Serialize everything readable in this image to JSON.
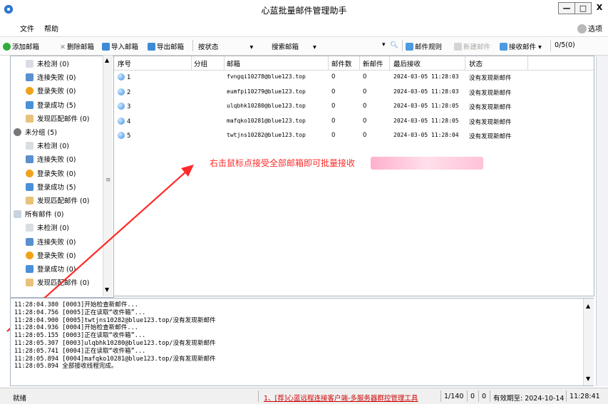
{
  "window": {
    "title": "心蓝批量邮件管理助手",
    "buttons": [
      "—",
      "□",
      "X"
    ]
  },
  "menubar": {
    "items": [
      "文件",
      "帮助"
    ],
    "options_label": "选项"
  },
  "toolbar": {
    "add": "添加邮箱",
    "delete": "删除邮箱",
    "import": "导入邮箱",
    "export": "导出邮箱",
    "status_filter": "按状态",
    "search_placeholder": "搜索邮箱",
    "search_arrow": "▾",
    "rules": "邮件规则",
    "new_mail": "新建邮件",
    "receive": "接收邮件",
    "counter": "0/5(0)"
  },
  "tree": {
    "items": [
      {
        "label": "未检测 (0)",
        "indent": 1,
        "icon": "question-icon"
      },
      {
        "label": "连接失败 (0)",
        "indent": 1,
        "icon": "connect-fail-icon"
      },
      {
        "label": "登录失败 (0)",
        "indent": 1,
        "icon": "login-fail-icon"
      },
      {
        "label": "登录成功 (5)",
        "indent": 1,
        "icon": "login-success-icon"
      },
      {
        "label": "发现匹配邮件 (0)",
        "indent": 1,
        "icon": "match-mail-icon"
      },
      {
        "label": "未分组 (5)",
        "indent": 0,
        "icon": "person-icon"
      },
      {
        "label": "未检测 (0)",
        "indent": 1,
        "icon": "question-icon"
      },
      {
        "label": "连接失败 (0)",
        "indent": 1,
        "icon": "connect-fail-icon"
      },
      {
        "label": "登录失败 (0)",
        "indent": 1,
        "icon": "login-fail-icon"
      },
      {
        "label": "登录成功 (5)",
        "indent": 1,
        "icon": "login-success-icon"
      },
      {
        "label": "发现匹配邮件 (0)",
        "indent": 1,
        "icon": "match-mail-icon"
      },
      {
        "label": "所有邮件 (0)",
        "indent": 0,
        "icon": "all-mail-icon"
      },
      {
        "label": "未检测 (0)",
        "indent": 1,
        "icon": "question-icon"
      },
      {
        "label": "连接失败 (0)",
        "indent": 1,
        "icon": "connect-fail-icon"
      },
      {
        "label": "登录失败 (0)",
        "indent": 1,
        "icon": "login-fail-icon"
      },
      {
        "label": "登录成功 (0)",
        "indent": 1,
        "icon": "login-success-icon"
      },
      {
        "label": "发现匹配邮件 (0)",
        "indent": 1,
        "icon": "match-mail-icon"
      }
    ]
  },
  "grid": {
    "columns": [
      "序号",
      "分组",
      "邮箱",
      "邮件数",
      "新邮件",
      "最后接收",
      "状态"
    ],
    "rows": [
      {
        "no": "1",
        "group": "",
        "email": "fvngqi10278@blue123.top",
        "count": "0",
        "new": "0",
        "last": "2024-03-05 11:28:03",
        "status": "没有发现新邮件"
      },
      {
        "no": "2",
        "group": "",
        "email": "eumfpi10279@blue123.top",
        "count": "0",
        "new": "0",
        "last": "2024-03-05 11:28:03",
        "status": "没有发现新邮件"
      },
      {
        "no": "3",
        "group": "",
        "email": "ulqbhk10280@blue123.top",
        "count": "0",
        "new": "0",
        "last": "2024-03-05 11:28:05",
        "status": "没有发现新邮件"
      },
      {
        "no": "4",
        "group": "",
        "email": "mafqko10281@blue123.top",
        "count": "0",
        "new": "0",
        "last": "2024-03-05 11:28:05",
        "status": "没有发现新邮件"
      },
      {
        "no": "5",
        "group": "",
        "email": "twtjns10282@blue123.top",
        "count": "0",
        "new": "0",
        "last": "2024-03-05 11:28:04",
        "status": "没有发现新邮件"
      }
    ]
  },
  "annotation": {
    "text": "右击鼠标点接受全部邮箱即可批量接收",
    "color": "#ff2a2a"
  },
  "log": {
    "lines": [
      "11:28:04.380 [0003]开始检查新邮件...",
      "11:28:04.756 [0005]正在读取“收件箱”...",
      "11:28:04.900 [0005]twtjns10282@blue123.top/没有发现新邮件",
      "11:28:04.936 [0004]开始检查新邮件...",
      "11:28:05.155 [0003]正在读取“收件箱”...",
      "11:28:05.307 [0003]ulqbhk10280@blue123.top/没有发现新邮件",
      "11:28:05.741 [0004]正在读取“收件箱”...",
      "11:28:05.894 [0004]mafqko10281@blue123.top/没有发现新邮件",
      "11:28:05.894 全部接收线程完成。"
    ]
  },
  "statusbar": {
    "ready": "就绪",
    "link": "1、[荐]心蓝远程连接客户端-多服务器群控管理工具",
    "page": "1/140",
    "n1": "0",
    "n2": "0",
    "expiry": "有效期至: 2024-10-14",
    "time": "11:28:41"
  },
  "colors": {
    "accent": "#2f7fd8",
    "arrow": "#ff2a2a",
    "link": "#cc0000"
  }
}
